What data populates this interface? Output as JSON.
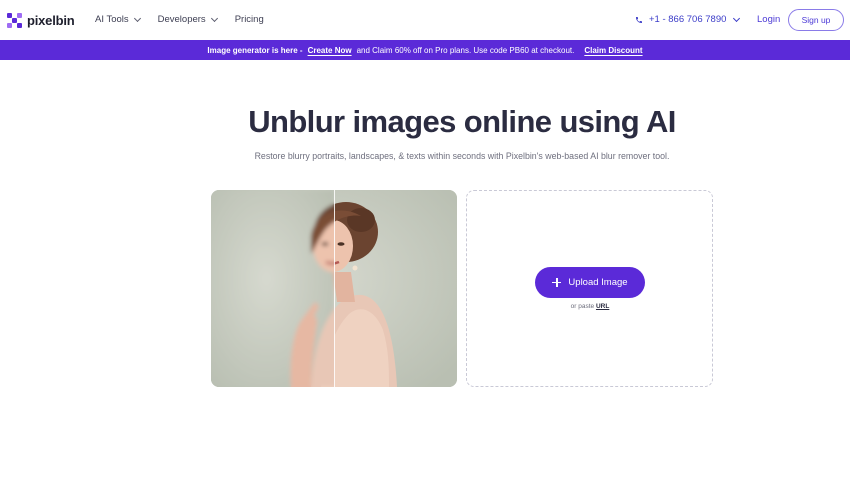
{
  "brand": {
    "name": "pixelbin",
    "logo_colors": [
      "#5b2ad8",
      "#9e6cf4"
    ]
  },
  "nav": {
    "items": [
      {
        "label": "AI Tools",
        "has_dropdown": true
      },
      {
        "label": "Developers",
        "has_dropdown": true
      },
      {
        "label": "Pricing",
        "has_dropdown": false
      }
    ],
    "phone": "+1 - 866 706 7890",
    "login_label": "Login",
    "signup_label": "Sign up"
  },
  "banner": {
    "lead": "Image generator is here -",
    "create_link": "Create Now",
    "message": "and Claim 60% off on Pro plans. Use code PB60 at checkout.",
    "claim_link": "Claim Discount",
    "background": "#5b2ad8"
  },
  "hero": {
    "title": "Unblur images online using AI",
    "subtitle": "Restore blurry portraits, landscapes, & texts within seconds with Pixelbin's web-based AI blur remover tool."
  },
  "preview": {
    "divider_ratio": 0.5
  },
  "upload": {
    "button_label": "Upload Image",
    "paste_text": "or paste",
    "url_label": "URL"
  },
  "colors": {
    "accent": "#5b2ad8",
    "text_dark": "#2b2c41",
    "text_muted": "#6e6f7e"
  }
}
